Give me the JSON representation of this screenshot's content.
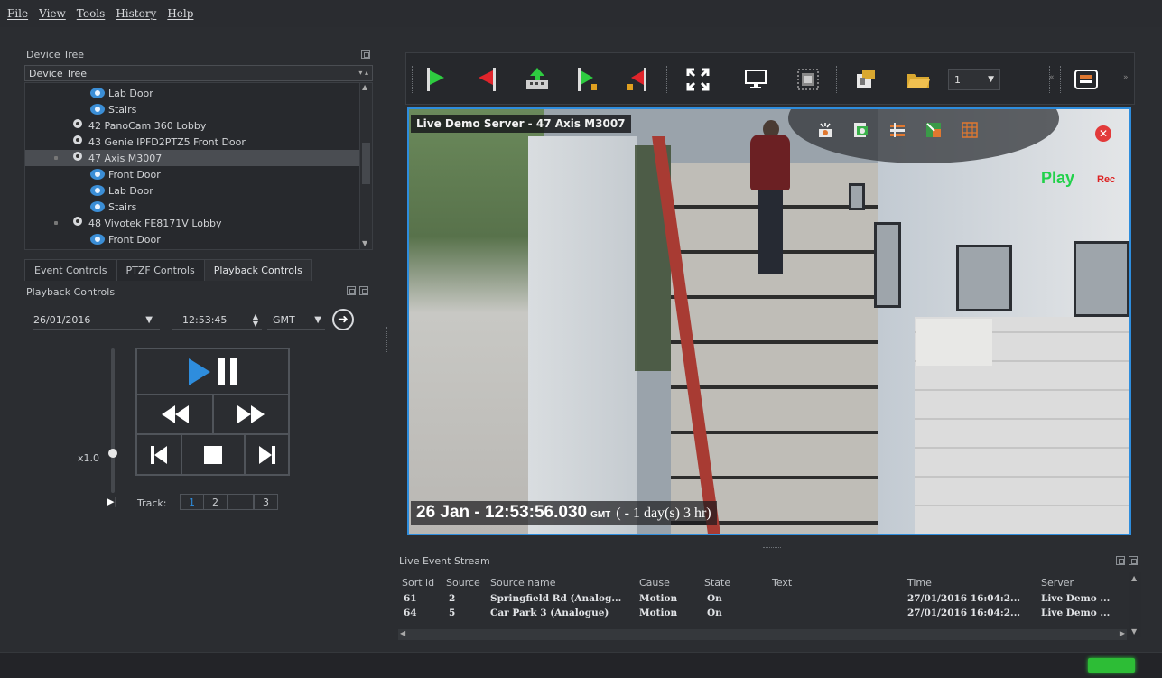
{
  "menu": [
    "File",
    "View",
    "Tools",
    "History",
    "Help"
  ],
  "device_tree": {
    "panel_title": "Device Tree",
    "combo_value": "Device Tree",
    "items": [
      {
        "label": "Lab Door",
        "kind": "eye"
      },
      {
        "label": "Stairs",
        "kind": "eye"
      },
      {
        "label": "42 PanoCam 360 Lobby",
        "kind": "cam"
      },
      {
        "label": "43 Genie IPFD2PTZ5 Front Door",
        "kind": "cam"
      },
      {
        "label": "47 Axis M3007",
        "kind": "cam",
        "selected": true
      },
      {
        "label": "Front Door",
        "kind": "eye"
      },
      {
        "label": "Lab Door",
        "kind": "eye"
      },
      {
        "label": "Stairs",
        "kind": "eye"
      },
      {
        "label": "48 Vivotek FE8171V Lobby",
        "kind": "cam"
      },
      {
        "label": "Front Door",
        "kind": "eye"
      }
    ]
  },
  "tabs": [
    "Event Controls",
    "PTZF Controls",
    "Playback Controls"
  ],
  "playback": {
    "panel_title": "Playback Controls",
    "date": "26/01/2016",
    "time": "12:53:45",
    "timezone": "GMT",
    "speed": "x1.0",
    "track_label": "Track:",
    "tracks": [
      "1",
      "2",
      "3"
    ]
  },
  "toolbar": {
    "layout_select": "1"
  },
  "video": {
    "title": "Live Demo Server - 47 Axis M3007",
    "play_label": "Play",
    "rec_label": "Rec",
    "timestamp_main": "26 Jan - 12:53:56.030",
    "timestamp_tz": "GMT",
    "timestamp_rel": "( - 1 day(s) 3 hr)",
    "close_glyph": "✕"
  },
  "events": {
    "title": "Live Event Stream",
    "columns": [
      "Sort id",
      "Source",
      "Source name",
      "Cause",
      "State",
      "Text",
      "Time",
      "Server"
    ],
    "rows": [
      [
        "61",
        "2",
        "Springfield Rd (Analog...",
        "Motion",
        "On",
        "",
        "27/01/2016 16:04:2...",
        "Live Demo ..."
      ],
      [
        "64",
        "5",
        "Car Park 3 (Analogue)",
        "Motion",
        "On",
        "",
        "27/01/2016 16:04:2...",
        "Live Demo ..."
      ]
    ]
  },
  "colors": {
    "accent_blue": "#2e8ddd",
    "play_green": "#21d14a",
    "rec_red": "#dd2222",
    "status_green": "#2dbd36"
  }
}
